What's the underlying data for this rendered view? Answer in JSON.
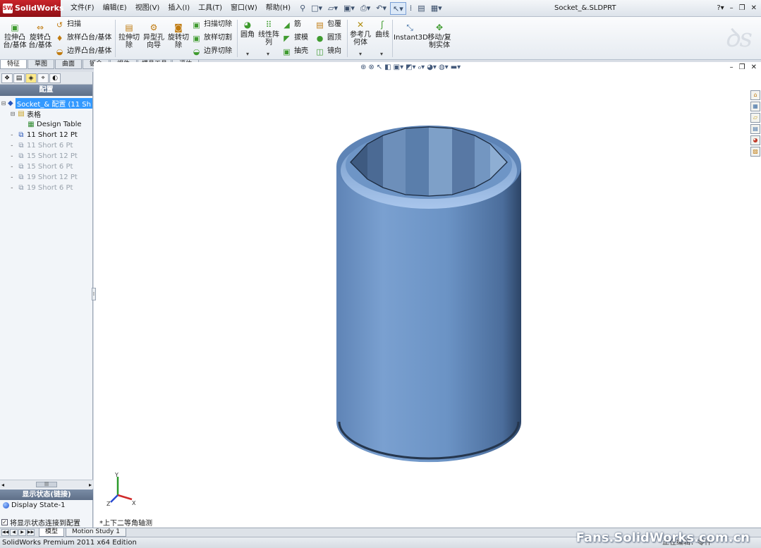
{
  "app": {
    "logo_text": "SolidWorks",
    "document_title": "Socket_&.SLDPRT"
  },
  "menu": [
    "文件(F)",
    "编辑(E)",
    "视图(V)",
    "插入(I)",
    "工具(T)",
    "窗口(W)",
    "帮助(H)"
  ],
  "command_manager": {
    "extrude_boss": "拉伸凸台/基体",
    "revolve_boss": "旋转凸台/基体",
    "sweep": "扫描",
    "loft": "放样凸台/基体",
    "boundary_boss": "边界凸台/基体",
    "extrude_cut": "拉伸切除",
    "hole_wizard": "异型孔向导",
    "revolve_cut": "旋转切除",
    "swept_cut": "扫描切除",
    "lofted_cut": "放样切割",
    "boundary_cut": "边界切除",
    "fillet": "圆角",
    "linear_pattern": "线性阵列",
    "rib": "筋",
    "draft": "拔模",
    "shell": "抽壳",
    "wrap": "包覆",
    "dome": "圆顶",
    "mirror": "镜向",
    "ref_geometry": "参考几何体",
    "curves": "曲线",
    "instant3d": "Instant3D",
    "move_copy": "移动/复制实体"
  },
  "tabs": [
    {
      "label": "特征",
      "active": true
    },
    {
      "label": "草图",
      "active": false
    },
    {
      "label": "曲面",
      "active": false
    },
    {
      "label": "钣金",
      "active": false
    },
    {
      "label": "焊件",
      "active": false
    },
    {
      "label": "模具工具",
      "active": false
    },
    {
      "label": "评估",
      "active": false
    }
  ],
  "config_panel": {
    "header": "配置",
    "root": "Socket_& 配置  (11 Sh",
    "table_folder": "表格",
    "design_table": "Design Table",
    "configs": [
      {
        "label": "11 Short 12 Pt",
        "active": true
      },
      {
        "label": "11 Short 6 Pt",
        "active": false
      },
      {
        "label": "15 Short 12 Pt",
        "active": false
      },
      {
        "label": "15 Short 6 Pt",
        "active": false
      },
      {
        "label": "19 Short 12 Pt",
        "active": false
      },
      {
        "label": "19 Short 6 Pt",
        "active": false
      }
    ],
    "scroll_mid": "|||"
  },
  "display_state": {
    "header": "显示状态(链接)",
    "item": "Display State-1",
    "link_checkbox": "将显示状态连接到配置",
    "link_checked": true
  },
  "viewport": {
    "view_name": "*上下二等角轴测",
    "triad_labels": {
      "x": "X",
      "y": "Y",
      "z": "Z"
    },
    "model_color": "#6b93c5"
  },
  "bottom_tabs": [
    {
      "label": "模型",
      "active": true
    },
    {
      "label": "Motion Study 1",
      "active": false
    }
  ],
  "status": {
    "left": "SolidWorks Premium 2011 x64 Edition",
    "right": "正在编辑：零件"
  },
  "watermark": "Fans.SolidWorks.com.cn"
}
